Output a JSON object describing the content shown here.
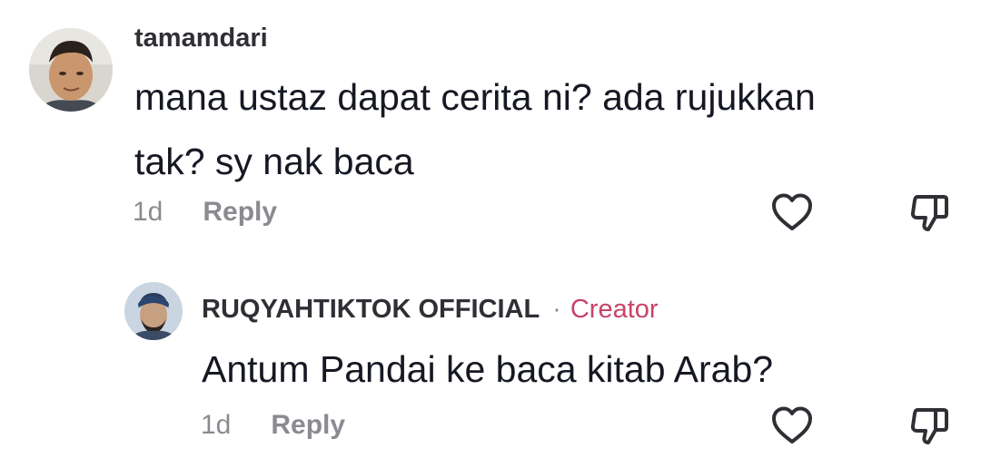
{
  "comments": [
    {
      "username": "tamamdari",
      "text_line1": "mana ustaz dapat cerita ni? ada rujukkan",
      "text_line2": "tak? sy nak baca",
      "time": "1d",
      "reply_label": "Reply",
      "like_icon": "heart-outline-icon",
      "dislike_icon": "thumbs-down-icon"
    }
  ],
  "replies": [
    {
      "username": "RUQYAHTIKTOK OFFICIAL",
      "separator": "·",
      "badge": "Creator",
      "text": "Antum Pandai ke baca kitab Arab?",
      "time": "1d",
      "reply_label": "Reply",
      "like_icon": "heart-outline-icon",
      "dislike_icon": "thumbs-down-icon"
    }
  ],
  "colors": {
    "text": "#161823",
    "username": "#2f2f35",
    "muted": "#8a8b91",
    "creator": "#c7436a",
    "icon": "#2f2f35"
  }
}
